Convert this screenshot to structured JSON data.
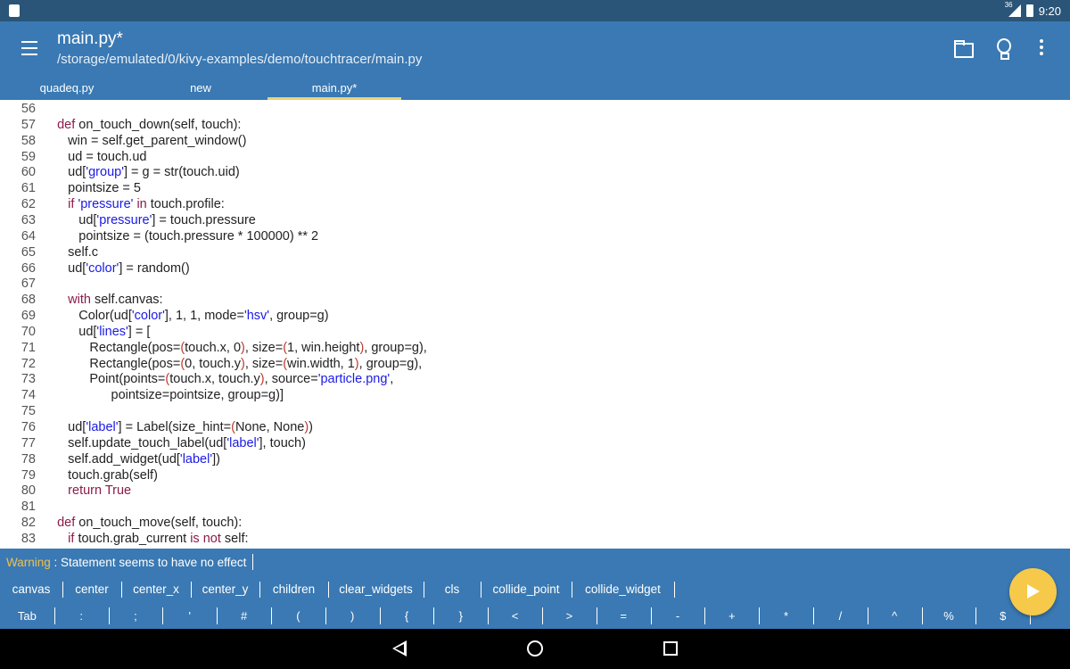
{
  "status": {
    "network": "36",
    "time": "9:20"
  },
  "appbar": {
    "title": "main.py*",
    "path": "/storage/emulated/0/kivy-examples/demo/touchtracer/main.py"
  },
  "tabs": [
    "quadeq.py",
    "new",
    "main.py*"
  ],
  "code_lines": [
    {
      "n": "56",
      "html": ""
    },
    {
      "n": "57",
      "html": "<span class='kw'>def</span> on_touch_down(self, touch):"
    },
    {
      "n": "58",
      "html": "   win = self.get_parent_window()"
    },
    {
      "n": "59",
      "html": "   ud = touch.ud"
    },
    {
      "n": "60",
      "html": "   ud[<span class='st'>'group'</span>] = g = str(touch.uid)"
    },
    {
      "n": "61",
      "html": "   pointsize = 5"
    },
    {
      "n": "62",
      "html": "   <span class='kw'>if</span> <span class='st'>'pressure'</span> <span class='kw'>in</span> touch.profile:"
    },
    {
      "n": "63",
      "html": "      ud[<span class='st'>'pressure'</span>] = touch.pressure"
    },
    {
      "n": "64",
      "html": "      pointsize = (touch.pressure * 100000) ** 2"
    },
    {
      "n": "65",
      "html": "   self.c"
    },
    {
      "n": "66",
      "html": "   ud[<span class='st'>'color'</span>] = random()"
    },
    {
      "n": "67",
      "html": ""
    },
    {
      "n": "68",
      "html": "   <span class='kw'>with</span> self.canvas:"
    },
    {
      "n": "69",
      "html": "      Color(ud[<span class='st'>'color'</span>], 1, 1, mode=<span class='st'>'hsv'</span>, group=g)"
    },
    {
      "n": "70",
      "html": "      ud[<span class='st'>'lines'</span>] = ["
    },
    {
      "n": "71",
      "html": "         Rectangle(pos=<span class='br'>(</span>touch.x, 0<span class='br'>)</span>, size=<span class='br'>(</span>1, win.height<span class='br'>)</span>, group=g),"
    },
    {
      "n": "72",
      "html": "         Rectangle(pos=<span class='br'>(</span>0, touch.y<span class='br'>)</span>, size=<span class='br'>(</span>win.width, 1<span class='br'>)</span>, group=g),"
    },
    {
      "n": "73",
      "html": "         Point(points=<span class='br'>(</span>touch.x, touch.y<span class='br'>)</span>, source=<span class='st'>'particle.png'</span>,"
    },
    {
      "n": "74",
      "html": "               pointsize=pointsize, group=g)]"
    },
    {
      "n": "75",
      "html": ""
    },
    {
      "n": "76",
      "html": "   ud[<span class='st'>'label'</span>] = Label(size_hint=<span class='br'>(</span>None, None<span class='br'>)</span>)"
    },
    {
      "n": "77",
      "html": "   self.update_touch_label(ud[<span class='st'>'label'</span>], touch)"
    },
    {
      "n": "78",
      "html": "   self.add_widget(ud[<span class='st'>'label'</span>])"
    },
    {
      "n": "79",
      "html": "   touch.grab(self)"
    },
    {
      "n": "80",
      "html": "   <span class='kw'>return True</span>"
    },
    {
      "n": "81",
      "html": ""
    },
    {
      "n": "82",
      "html": "<span class='kw'>def</span> on_touch_move(self, touch):"
    },
    {
      "n": "83",
      "html": "   <span class='kw'>if</span> touch.grab_current <span class='kw'>is not</span> self:"
    }
  ],
  "warning": {
    "label": "Warning",
    "message": " : Statement seems to have no effect"
  },
  "suggestions": [
    "canvas",
    "center",
    "center_x",
    "center_y",
    "children",
    "clear_widgets",
    "cls",
    "collide_point",
    "collide_widget"
  ],
  "keys": [
    "Tab",
    ":",
    ";",
    "'",
    "#",
    "(",
    ")",
    "{",
    "}",
    "<",
    ">",
    "=",
    "-",
    "+",
    "*",
    "/",
    "^",
    "%",
    "$"
  ]
}
